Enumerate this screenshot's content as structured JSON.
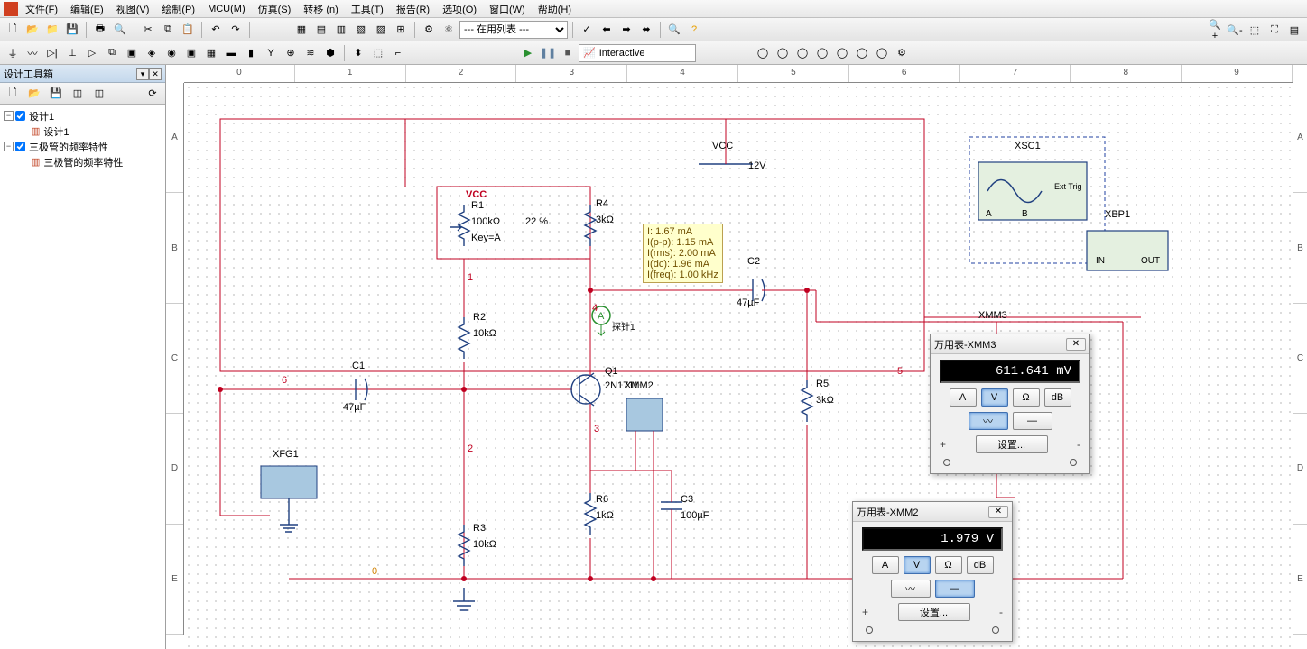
{
  "menu": {
    "items": [
      "文件(F)",
      "编辑(E)",
      "视图(V)",
      "绘制(P)",
      "MCU(M)",
      "仿真(S)",
      "转移 (n)",
      "工具(T)",
      "报告(R)",
      "选项(O)",
      "窗口(W)",
      "帮助(H)"
    ]
  },
  "toolbar": {
    "combo_label": "--- 在用列表 ---"
  },
  "sim": {
    "mode": "Interactive"
  },
  "sidebar": {
    "title": "设计工具箱",
    "projects": [
      {
        "name": "设计1",
        "file": "设计1"
      },
      {
        "name": "三极管的频率特性",
        "file": "三极管的频率特性"
      }
    ]
  },
  "ruler": {
    "h": [
      "0",
      "1",
      "2",
      "3",
      "4",
      "5",
      "6",
      "7",
      "8",
      "9"
    ],
    "v": [
      "A",
      "B",
      "C",
      "D",
      "E"
    ]
  },
  "schematic": {
    "vcc": {
      "name": "VCC",
      "value": "12V"
    },
    "r1": {
      "name": "R1",
      "value": "100kΩ",
      "pct": "22 %",
      "key": "Key=A",
      "net_top": "VCC"
    },
    "r2": {
      "name": "R2",
      "value": "10kΩ"
    },
    "r3": {
      "name": "R3",
      "value": "10kΩ"
    },
    "r4": {
      "name": "R4",
      "value": "3kΩ"
    },
    "r5": {
      "name": "R5",
      "value": "3kΩ"
    },
    "r6": {
      "name": "R6",
      "value": "1kΩ"
    },
    "c1": {
      "name": "C1",
      "value": "47µF"
    },
    "c2": {
      "name": "C2",
      "value": "47µF"
    },
    "c3": {
      "name": "C3",
      "value": "100µF"
    },
    "q1": {
      "name": "Q1",
      "value": "2N1711"
    },
    "xfg1": "XFG1",
    "xmm2": "XMM2",
    "xmm3": "XMM3",
    "xsc1": "XSC1",
    "xbp1": "XBP1",
    "nets": {
      "n0": "0",
      "n1": "1",
      "n2": "2",
      "n3": "3",
      "n4": "4",
      "n5": "5",
      "n6": "6"
    },
    "probe": {
      "name": "探针1",
      "lines": {
        "i": "I: 1.67 mA",
        "ipp": "I(p-p): 1.15 mA",
        "irms": "I(rms): 2.00 mA",
        "idc": "I(dc): 1.96 mA",
        "ifreq": "I(freq): 1.00 kHz"
      }
    }
  },
  "multimeter3": {
    "title": "万用表-XMM3",
    "reading": "611.641 mV",
    "buttons": {
      "a": "A",
      "v": "V",
      "ohm": "Ω",
      "db": "dB"
    },
    "active_mode": "v",
    "wave_active": "ac",
    "settings": "设置...",
    "plus": "+",
    "minus": "-"
  },
  "multimeter2": {
    "title": "万用表-XMM2",
    "reading": "1.979 V",
    "buttons": {
      "a": "A",
      "v": "V",
      "ohm": "Ω",
      "db": "dB"
    },
    "active_mode": "v",
    "wave_active": "dc",
    "settings": "设置...",
    "plus": "+",
    "minus": "-"
  },
  "scope": {
    "ext": "Ext Trig",
    "a": "A",
    "b": "B",
    "in": "IN",
    "out": "OUT"
  }
}
